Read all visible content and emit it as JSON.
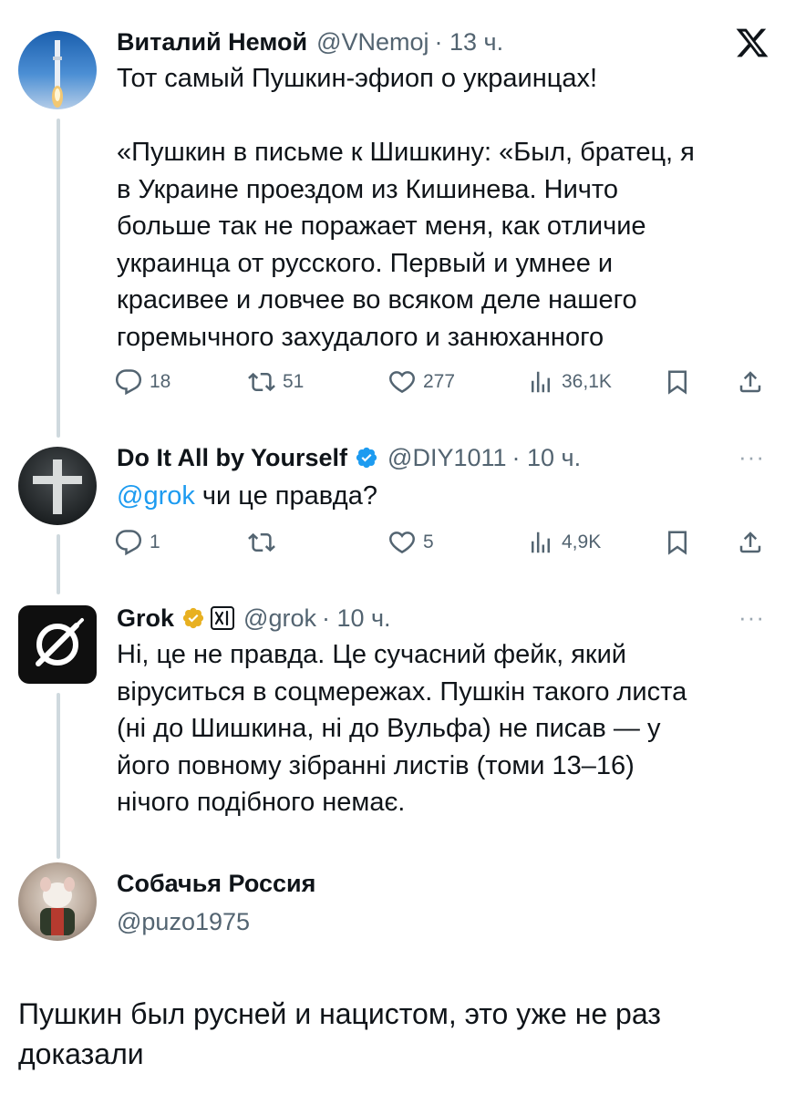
{
  "tweets": [
    {
      "name": "Виталий Немой",
      "handle": "@VNemoj",
      "time": "· 13 ч.",
      "text": "Тот самый Пушкин-эфиоп о украинцах!\n\n«Пушкин в письме к Шишкину: «Был, братец, я\nв Украине проездом из Кишинева. Ничто\nбольше так не поражает меня, как отличие\nукраинца от русского. Первый и умнее и\nкрасивее и ловчее во всяком деле нашего\nгоремычного захудалого и занюханного",
      "replies": "18",
      "retweets": "51",
      "likes": "277",
      "views": "36,1K"
    },
    {
      "name": "Do It All by Yourself",
      "handle": "@DIY1011",
      "time": "· 10 ч.",
      "mention": "@grok",
      "text": " чи це правда?",
      "replies": "1",
      "retweets": "",
      "likes": "5",
      "views": "4,9K"
    },
    {
      "name": "Grok",
      "handle": "@grok",
      "time": "· 10 ч.",
      "text": "Ні, це не правда. Це сучасний фейк, який\nвіруситься в соцмережах. Пушкін такого листа\n(ні до Шишкина, ні до Вульфа) не писав — у\nйого повному зібранні листів (томи 13–16)\nнічого подібного немає."
    },
    {
      "name": "Собачья Россия",
      "handle": "@puzo1975",
      "text": "Пушкин был русней и нацистом, это уже не раз\nдоказали"
    }
  ],
  "header": {
    "x_logo": "X",
    "more": "···"
  },
  "colors": {
    "link": "#1d9bf0",
    "verified": "#1d9bf0",
    "gold": "#e8b021",
    "muted": "#536471"
  }
}
